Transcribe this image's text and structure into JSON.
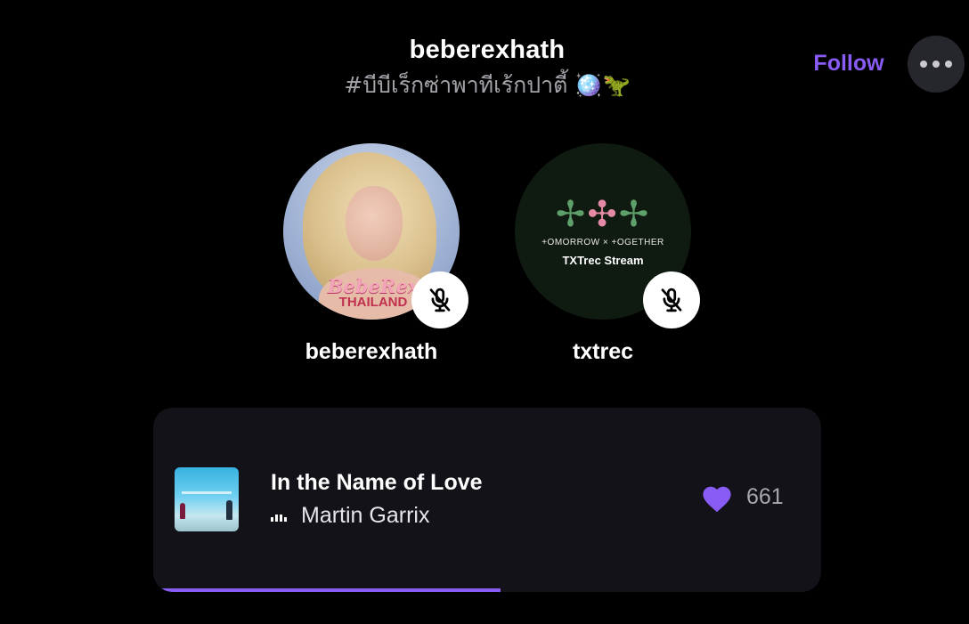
{
  "header": {
    "title": "beberexhath",
    "subtitle": "#บีบีเร็กซ่าพาทีเร้กปาตี้ 🪩🦖",
    "follow_label": "Follow",
    "more_icon": "more-horizontal-icon"
  },
  "speakers": [
    {
      "name": "beberexhath",
      "mic_state": "muted",
      "mic_icon": "mic-off-icon",
      "avatar_text_1": "BebeRex",
      "avatar_text_2": "THAILAND"
    },
    {
      "name": "txtrec",
      "mic_state": "muted",
      "mic_icon": "mic-off-icon",
      "avatar_tagline": "+OMORROW × +OGETHER",
      "avatar_text": "TXTrec Stream"
    }
  ],
  "now_playing": {
    "title": "In the Name of Love",
    "artist": "Martin Garrix",
    "likes": "661",
    "progress": 0.52
  },
  "colors": {
    "accent": "#8a5cf6",
    "background": "#000000",
    "card": "#121218"
  }
}
